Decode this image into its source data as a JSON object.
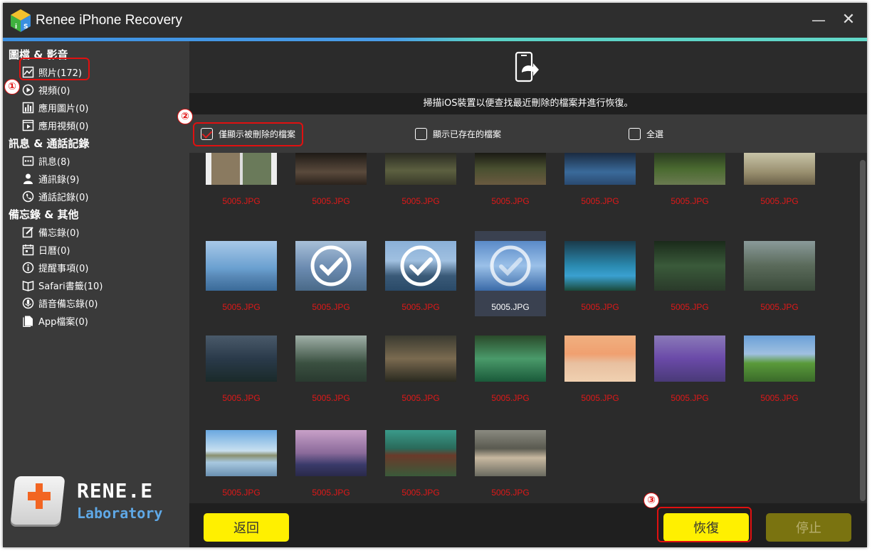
{
  "window": {
    "title": "Renee iPhone Recovery"
  },
  "sidebar": {
    "sections": [
      {
        "title": "圖檔 & 影音",
        "items": [
          {
            "label": "照片(172)",
            "icon": "image-icon"
          },
          {
            "label": "視頻(0)",
            "icon": "play-circle-icon"
          },
          {
            "label": "應用圖片(0)",
            "icon": "bar-chart-icon"
          },
          {
            "label": "應用視頻(0)",
            "icon": "video-frame-icon"
          }
        ]
      },
      {
        "title": "訊息 & 通話記錄",
        "items": [
          {
            "label": "訊息(8)",
            "icon": "message-icon"
          },
          {
            "label": "通訊錄(9)",
            "icon": "person-icon"
          },
          {
            "label": "通話記錄(0)",
            "icon": "phone-clock-icon"
          }
        ]
      },
      {
        "title": "備忘錄 & 其他",
        "items": [
          {
            "label": "備忘錄(0)",
            "icon": "note-edit-icon"
          },
          {
            "label": "日曆(0)",
            "icon": "calendar-icon"
          },
          {
            "label": "提醒事項(0)",
            "icon": "info-circle-icon"
          },
          {
            "label": "Safari書籤(10)",
            "icon": "book-icon"
          },
          {
            "label": "語音備忘錄(0)",
            "icon": "microphone-icon"
          },
          {
            "label": "App檔案(0)",
            "icon": "file-icon"
          }
        ]
      }
    ],
    "brand": {
      "title": "RENE.E",
      "subtitle": "Laboratory"
    }
  },
  "main": {
    "info_text": "掃描iOS裝置以便查找最近刪除的檔案并進行恢復。",
    "filters": [
      {
        "label": "僅顯示被刪除的檔案",
        "checked": true
      },
      {
        "label": "顯示已存在的檔案",
        "checked": false
      },
      {
        "label": "全選",
        "checked": false
      }
    ],
    "files": [
      {
        "name": "5005.JPG",
        "state": "none"
      },
      {
        "name": "5005.JPG",
        "state": "none"
      },
      {
        "name": "5005.JPG",
        "state": "none"
      },
      {
        "name": "5005.JPG",
        "state": "none"
      },
      {
        "name": "5005.JPG",
        "state": "none"
      },
      {
        "name": "5005.JPG",
        "state": "none"
      },
      {
        "name": "5005.JPG",
        "state": "none"
      },
      {
        "name": "5005.JPG",
        "state": "none"
      },
      {
        "name": "5005.JPG",
        "state": "checked"
      },
      {
        "name": "5005.JPG",
        "state": "checked"
      },
      {
        "name": "5005.JPG",
        "state": "selected"
      },
      {
        "name": "5005.JPG",
        "state": "none"
      },
      {
        "name": "5005.JPG",
        "state": "none"
      },
      {
        "name": "5005.JPG",
        "state": "none"
      },
      {
        "name": "5005.JPG",
        "state": "none"
      },
      {
        "name": "5005.JPG",
        "state": "none"
      },
      {
        "name": "5005.JPG",
        "state": "none"
      },
      {
        "name": "5005.JPG",
        "state": "none"
      },
      {
        "name": "5005.JPG",
        "state": "none"
      },
      {
        "name": "5005.JPG",
        "state": "none"
      },
      {
        "name": "5005.JPG",
        "state": "none"
      },
      {
        "name": "5005.JPG",
        "state": "none"
      },
      {
        "name": "5005.JPG",
        "state": "none"
      },
      {
        "name": "5005.JPG",
        "state": "none"
      },
      {
        "name": "5005.JPG",
        "state": "none"
      }
    ],
    "buttons": {
      "back": "返回",
      "recover": "恢復",
      "stop": "停止"
    }
  },
  "annotations": [
    "①",
    "②",
    "③"
  ],
  "colors": {
    "accent": "#fff000",
    "warning": "#e01818",
    "panel": "#3a3a3a",
    "background": "#2b2b2b"
  }
}
